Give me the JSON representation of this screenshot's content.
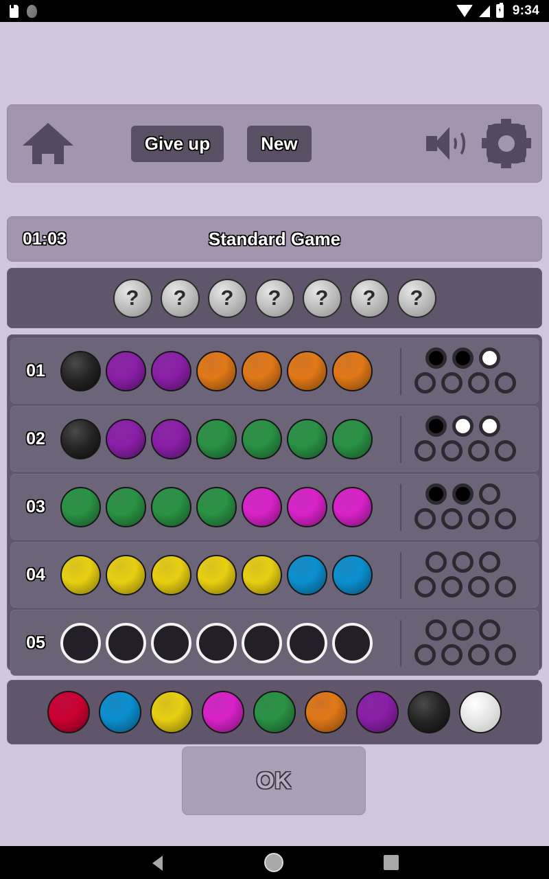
{
  "status_bar": {
    "time": "9:34",
    "icons": [
      "sdcard-icon",
      "blob-icon",
      "wifi-icon",
      "signal-icon",
      "battery-icon"
    ]
  },
  "toolbar": {
    "home_icon": "home-icon",
    "give_up_label": "Give up",
    "new_label": "New",
    "sound_icon": "speaker-icon",
    "settings_icon": "gear-icon"
  },
  "status_line": {
    "timer": "01:03",
    "title": "Standard Game"
  },
  "secret": {
    "count": 7,
    "symbol": "?"
  },
  "colors": {
    "background": "#d2c6dd",
    "panel": "#a295ad",
    "board": "#5f566b",
    "row": "#6c6478",
    "red": "#cc0033",
    "blue": "#0c8fcf",
    "yellow": "#e8cf12",
    "magenta": "#d922c9",
    "green": "#2a9244",
    "orange": "#e07818",
    "purple": "#8b1fa8",
    "black": "#262626",
    "white": "#f2f2f2"
  },
  "board": {
    "rows": [
      {
        "label": "01",
        "guess": [
          "black",
          "purple",
          "purple",
          "orange",
          "orange",
          "orange",
          "orange"
        ],
        "feedback": [
          "black",
          "black",
          "white",
          "none",
          "none",
          "none",
          "none"
        ],
        "active": false
      },
      {
        "label": "02",
        "guess": [
          "black",
          "purple",
          "purple",
          "green",
          "green",
          "green",
          "green"
        ],
        "feedback": [
          "black",
          "white",
          "white",
          "none",
          "none",
          "none",
          "none"
        ],
        "active": false
      },
      {
        "label": "03",
        "guess": [
          "green",
          "green",
          "green",
          "green",
          "magenta",
          "magenta",
          "magenta"
        ],
        "feedback": [
          "black",
          "black",
          "none",
          "none",
          "none",
          "none",
          "none"
        ],
        "active": false
      },
      {
        "label": "04",
        "guess": [
          "yellow",
          "yellow",
          "yellow",
          "yellow",
          "yellow",
          "blue",
          "blue"
        ],
        "feedback": [
          "none",
          "none",
          "none",
          "none",
          "none",
          "none",
          "none"
        ],
        "active": false
      },
      {
        "label": "05",
        "guess": [
          "empty",
          "empty",
          "empty",
          "empty",
          "empty",
          "empty",
          "empty"
        ],
        "feedback": [
          "none",
          "none",
          "none",
          "none",
          "none",
          "none",
          "none"
        ],
        "active": true
      }
    ]
  },
  "palette": {
    "swatches": [
      "red",
      "blue",
      "yellow",
      "magenta",
      "green",
      "orange",
      "purple",
      "black",
      "white"
    ]
  },
  "submit": {
    "ok_label": "OK"
  },
  "nav_bar": {
    "back_icon": "back-triangle-icon",
    "home_icon": "home-circle-icon",
    "recents_icon": "recents-square-icon"
  }
}
